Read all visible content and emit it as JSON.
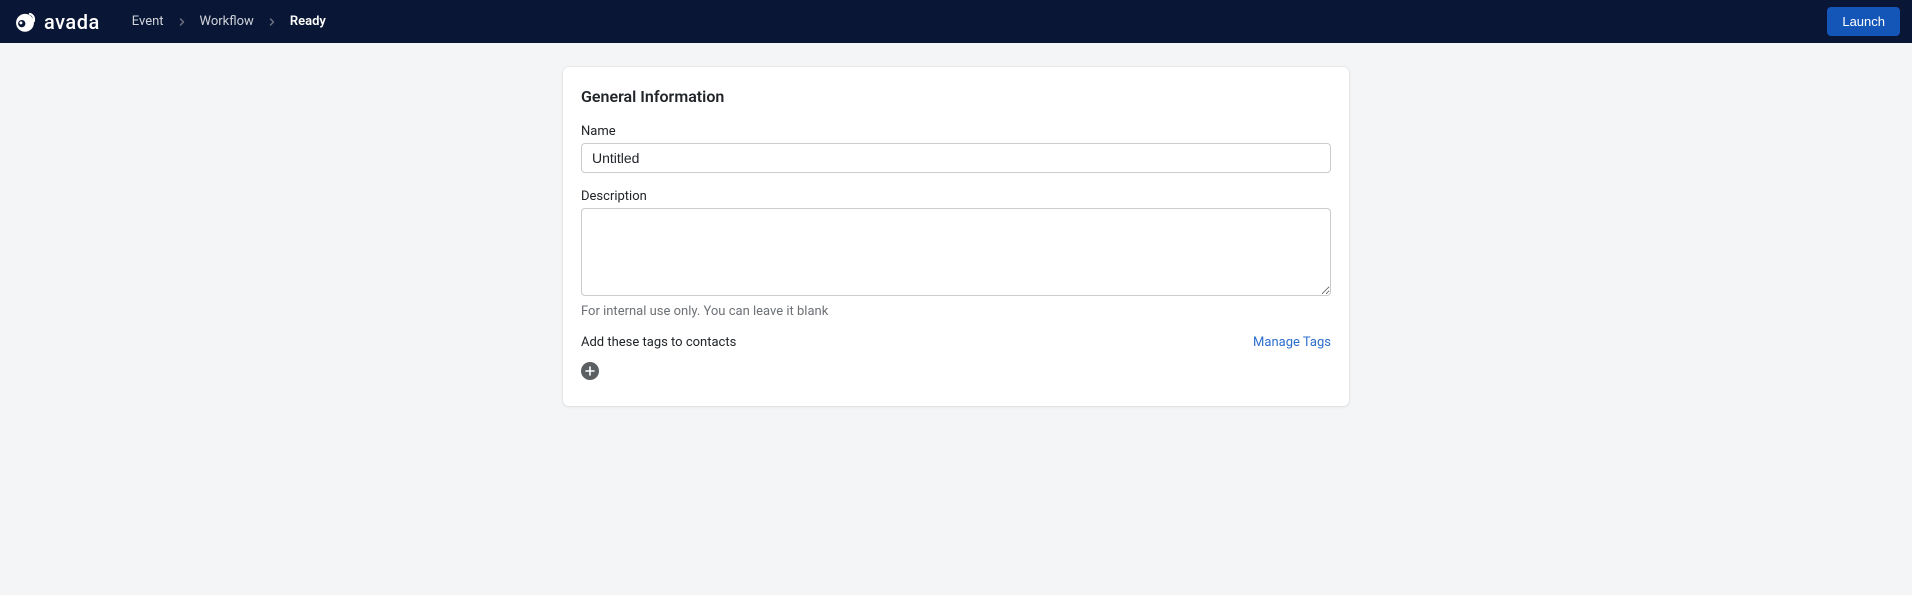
{
  "brand": "avada",
  "breadcrumb": {
    "items": [
      {
        "label": "Event",
        "active": false
      },
      {
        "label": "Workflow",
        "active": false
      },
      {
        "label": "Ready",
        "active": true
      }
    ]
  },
  "header": {
    "launch_label": "Launch"
  },
  "card": {
    "title": "General Information",
    "name_label": "Name",
    "name_value": "Untitled",
    "description_label": "Description",
    "description_value": "",
    "description_helper": "For internal use only. You can leave it blank",
    "tags_label": "Add these tags to contacts",
    "manage_tags_label": "Manage Tags"
  }
}
